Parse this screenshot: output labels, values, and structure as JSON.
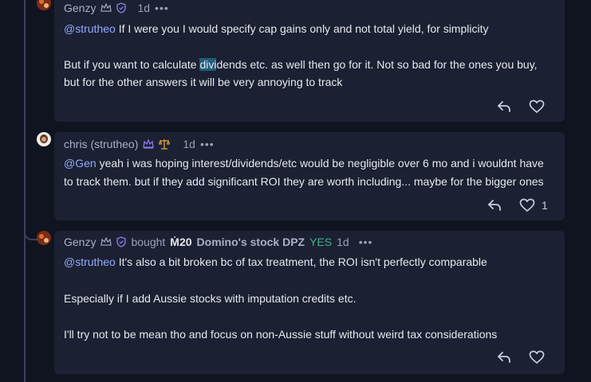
{
  "comments": [
    {
      "author": "Genzy",
      "time": "1d",
      "mention": "@strutheo",
      "line1_rest": " If I were you I would specify cap gains only and not total yield, for simplicity",
      "line2_pre": "But if you want to calculate ",
      "line2_hl": "divi",
      "line2_post": "dends etc. as well then go for it. Not so bad for the ones you buy,",
      "line3": "but for the other answers it will be very annoying to track",
      "likes": ""
    },
    {
      "author": "chris (strutheo)",
      "time": "1d",
      "mention": "@Gen",
      "line1_rest": " yeah i was hoping interest/dividends/etc would be negligible over 6 mo and i wouldnt have",
      "line2": "to track them. but if they add significant ROI they are worth including... maybe for the bigger ones",
      "likes": "1"
    },
    {
      "author": "Genzy",
      "bought": "bought",
      "amount": "Ṁ20",
      "market": "Domino's stock DPZ",
      "outcome": "YES",
      "time": "1d",
      "mention": "@strutheo",
      "line1_rest": " It's also a bit broken bc of tax treatment, the ROI isn't perfectly comparable",
      "line2": "Especially if I add Aussie stocks with imputation credits etc.",
      "line3": "I'll try not to be mean tho and focus on non-Aussie stuff without weird tax considerations",
      "likes": ""
    }
  ],
  "more_dots": "•••",
  "icons": {
    "reply": "reply-icon",
    "like": "heart-icon",
    "rank": "crown-icon",
    "shield": "shield-icon",
    "scales": "scales-icon"
  },
  "colors": {
    "mention": "#93a9ff",
    "yes": "#3fb38f",
    "card_bg": "#1b2132",
    "page_bg": "#101420"
  }
}
